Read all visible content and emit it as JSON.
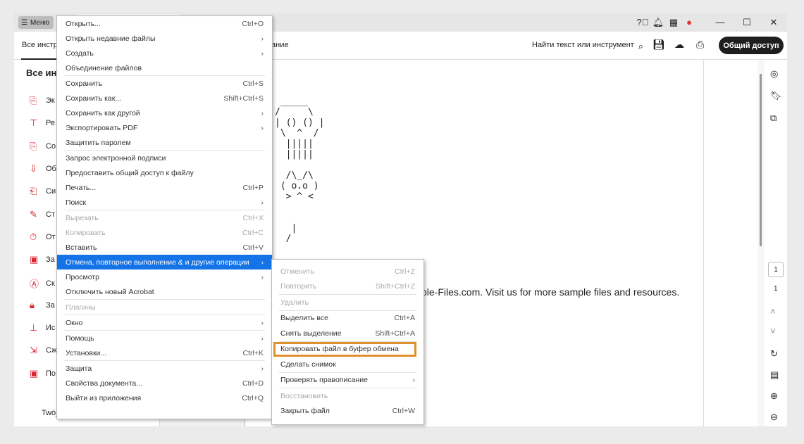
{
  "titlebar": {
    "menu_label": "Меню",
    "icons": [
      "help-icon",
      "bell-icon",
      "apps-icon",
      "avatar"
    ],
    "window_controls": [
      "minimize",
      "maximize",
      "close"
    ]
  },
  "toolbar": {
    "tab_all_tools": "Все инстру",
    "tab_partial": "ание",
    "search_label": "Найти текст или инструмент",
    "share_label": "Общий доступ"
  },
  "left_panel": {
    "heading": "Все инс",
    "items": [
      "Эк",
      "Ре",
      "Со",
      "Об",
      "Си",
      "Ст",
      "От",
      "За",
      "Ск",
      "За",
      "Ис",
      "Сж",
      "По"
    ],
    "footer": "Twój"
  },
  "document": {
    "ascii": " _____\n/     \\\n| () () |\n \\  ^  /\n  |||||\n  |||||\n\n  /\\_/\\\n ( o.o )\n  > ^ <\n\n\n   |\n  /",
    "text": "ple-Files.com. Visit us for more sample files and resources."
  },
  "right_rail": {
    "page_current": "1",
    "page_total": "1"
  },
  "menu": {
    "items": [
      {
        "label": "Открыть...",
        "shortcut": "Ctrl+O"
      },
      {
        "label": "Открыть недавние файлы",
        "shortcut": "›"
      },
      {
        "label": "Создать",
        "shortcut": "›"
      },
      {
        "label": "Объединение файлов",
        "shortcut": ""
      },
      {
        "sep": true
      },
      {
        "label": "Сохранить",
        "shortcut": "Ctrl+S"
      },
      {
        "label": "Сохранить как...",
        "shortcut": "Shift+Ctrl+S"
      },
      {
        "label": "Сохранить как другой",
        "shortcut": "›"
      },
      {
        "label": "Экспортировать PDF",
        "shortcut": "›"
      },
      {
        "label": "Защитить паролем",
        "shortcut": ""
      },
      {
        "sep": true
      },
      {
        "label": "Запрос электронной подписи",
        "shortcut": ""
      },
      {
        "label": "Предоставить общий доступ к файлу",
        "shortcut": ""
      },
      {
        "label": "Печать...",
        "shortcut": "Ctrl+P"
      },
      {
        "label": "Поиск",
        "shortcut": "›"
      },
      {
        "sep": true
      },
      {
        "label": "Вырезать",
        "shortcut": "Ctrl+X",
        "disabled": true
      },
      {
        "label": "Копировать",
        "shortcut": "Ctrl+C",
        "disabled": true
      },
      {
        "label": "Вставить",
        "shortcut": "Ctrl+V"
      },
      {
        "label": "Отмена, повторное выполнение & и другие операции",
        "shortcut": "›",
        "highlighted": true
      },
      {
        "label": "Просмотр",
        "shortcut": "›"
      },
      {
        "label": "Отключить новый Acrobat",
        "shortcut": ""
      },
      {
        "sep": true
      },
      {
        "label": "Плагины",
        "shortcut": "",
        "disabled": true
      },
      {
        "sep": true
      },
      {
        "label": "Окно",
        "shortcut": "›"
      },
      {
        "sep": true
      },
      {
        "label": "Помощь",
        "shortcut": "›"
      },
      {
        "label": "Установки...",
        "shortcut": "Ctrl+K"
      },
      {
        "sep": true
      },
      {
        "label": "Защита",
        "shortcut": "›"
      },
      {
        "label": "Свойства документа...",
        "shortcut": "Ctrl+D"
      },
      {
        "label": "Выйти из приложения",
        "shortcut": "Ctrl+Q"
      }
    ]
  },
  "submenu": {
    "items": [
      {
        "label": "Отменить",
        "shortcut": "Ctrl+Z",
        "disabled": true
      },
      {
        "label": "Повторить",
        "shortcut": "Shift+Ctrl+Z",
        "disabled": true
      },
      {
        "sep": true
      },
      {
        "label": "Удалить",
        "shortcut": "",
        "disabled": true
      },
      {
        "sep": true
      },
      {
        "label": "Выделить все",
        "shortcut": "Ctrl+A"
      },
      {
        "label": "Снять выделение",
        "shortcut": "Shift+Ctrl+A"
      },
      {
        "sep": true
      },
      {
        "label": "Копировать файл в буфер обмена",
        "shortcut": "",
        "boxed": true
      },
      {
        "label": "Сделать снимок",
        "shortcut": ""
      },
      {
        "sep": true
      },
      {
        "label": "Проверять правописание",
        "shortcut": "›"
      },
      {
        "sep": true
      },
      {
        "label": "Восстановить",
        "shortcut": "",
        "disabled": true
      },
      {
        "label": "Закрыть файл",
        "shortcut": "Ctrl+W"
      }
    ]
  },
  "colors": {
    "highlight": "#1473e6",
    "callout": "#e0902c",
    "share_bg": "#1e1e1e",
    "tool_icon": "#d9232e"
  }
}
